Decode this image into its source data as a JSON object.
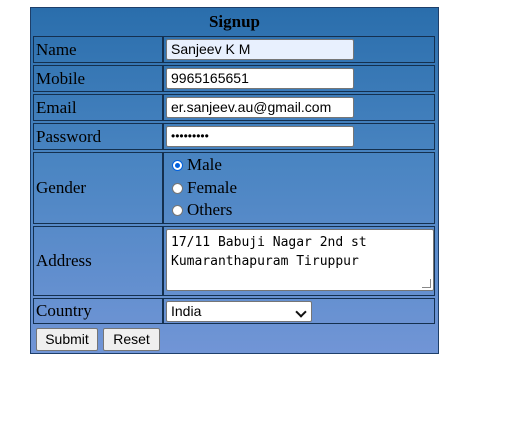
{
  "form": {
    "title": "Signup",
    "labels": {
      "name": "Name",
      "mobile": "Mobile",
      "email": "Email",
      "password": "Password",
      "gender": "Gender",
      "address": "Address",
      "country": "Country"
    },
    "values": {
      "name": "Sanjeev K M",
      "mobile": "9965165651",
      "email": "er.sanjeev.au@gmail.com",
      "password": "•••••••••",
      "address_line1": "17/11 Babuji Nagar 2nd st",
      "address_line2": "Kumaranthapuram Tiruppur",
      "country": "India"
    },
    "gender_options": [
      "Male",
      "Female",
      "Others"
    ],
    "gender_selected": "Male",
    "buttons": {
      "submit": "Submit",
      "reset": "Reset"
    }
  }
}
